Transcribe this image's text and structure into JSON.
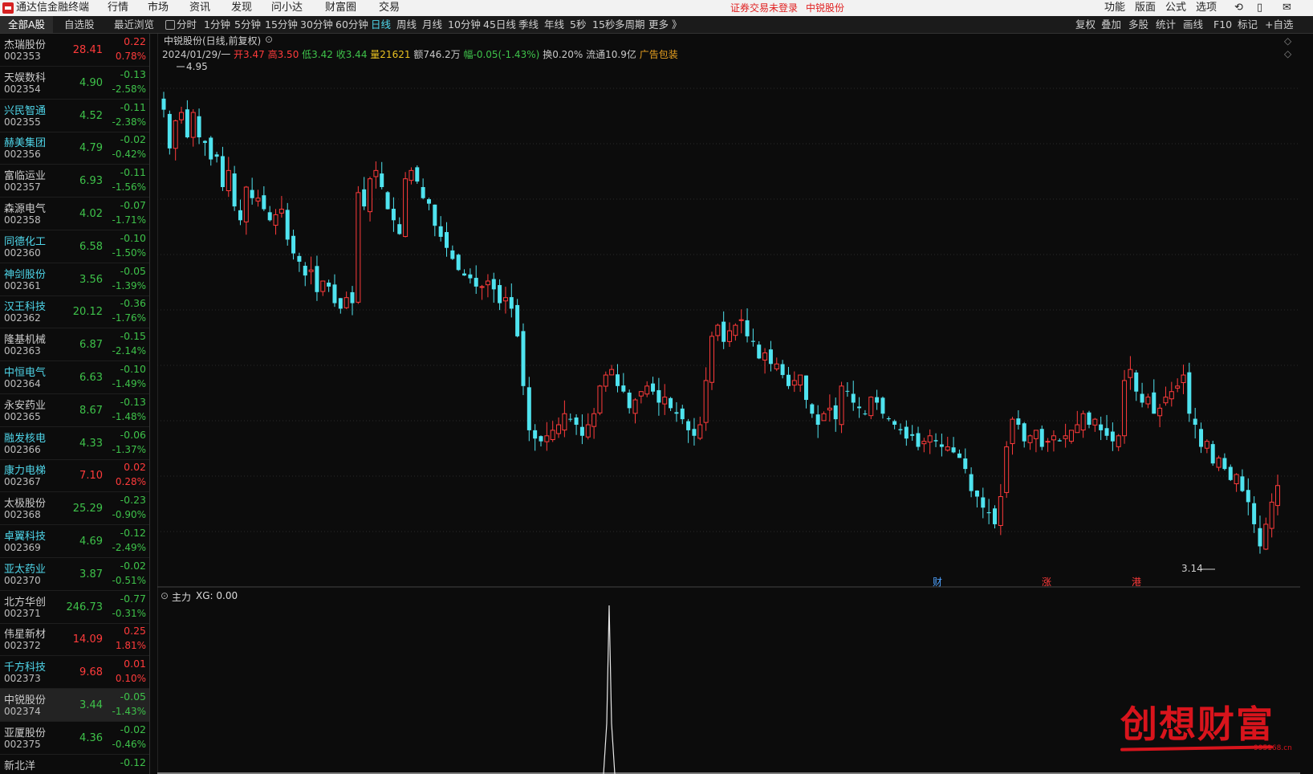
{
  "menubar": {
    "app_title": "通达信金融终端",
    "items": [
      "行情",
      "市场",
      "资讯",
      "发现",
      "问小达",
      "财富圈",
      "交易"
    ],
    "notice": "证券交易未登录",
    "stock_name": "中锐股份",
    "right_items": [
      "功能",
      "版面",
      "公式",
      "选项"
    ]
  },
  "toolbar": {
    "sidebar_tabs": [
      "全部A股",
      "自选股",
      "最近浏览"
    ],
    "periods": [
      "分时",
      "1分钟",
      "5分钟",
      "15分钟",
      "30分钟",
      "60分钟",
      "日线",
      "周线",
      "月线",
      "10分钟",
      "45日线",
      "季线",
      "年线",
      "5秒",
      "15秒",
      "多周期",
      "更多 》"
    ],
    "active_period": "日线",
    "right_tools": [
      "复权",
      "叠加",
      "多股",
      "统计",
      "画线",
      "F10",
      "标记",
      "+自选"
    ]
  },
  "stocks": [
    {
      "name": "杰瑞股份",
      "code": "002353",
      "price": "28.41",
      "change": "0.22",
      "pct": "0.78%",
      "dir": "up",
      "hl": false
    },
    {
      "name": "天娱数科",
      "code": "002354",
      "price": "4.90",
      "change": "-0.13",
      "pct": "-2.58%",
      "dir": "dn",
      "hl": false
    },
    {
      "name": "兴民智通",
      "code": "002355",
      "price": "4.52",
      "change": "-0.11",
      "pct": "-2.38%",
      "dir": "dn",
      "hl": true
    },
    {
      "name": "赫美集团",
      "code": "002356",
      "price": "4.79",
      "change": "-0.02",
      "pct": "-0.42%",
      "dir": "dn",
      "hl": true
    },
    {
      "name": "富临运业",
      "code": "002357",
      "price": "6.93",
      "change": "-0.11",
      "pct": "-1.56%",
      "dir": "dn",
      "hl": false
    },
    {
      "name": "森源电气",
      "code": "002358",
      "price": "4.02",
      "change": "-0.07",
      "pct": "-1.71%",
      "dir": "dn",
      "hl": false
    },
    {
      "name": "同德化工",
      "code": "002360",
      "price": "6.58",
      "change": "-0.10",
      "pct": "-1.50%",
      "dir": "dn",
      "hl": true
    },
    {
      "name": "神剑股份",
      "code": "002361",
      "price": "3.56",
      "change": "-0.05",
      "pct": "-1.39%",
      "dir": "dn",
      "hl": true
    },
    {
      "name": "汉王科技",
      "code": "002362",
      "price": "20.12",
      "change": "-0.36",
      "pct": "-1.76%",
      "dir": "dn",
      "hl": true
    },
    {
      "name": "隆基机械",
      "code": "002363",
      "price": "6.87",
      "change": "-0.15",
      "pct": "-2.14%",
      "dir": "dn",
      "hl": false
    },
    {
      "name": "中恒电气",
      "code": "002364",
      "price": "6.63",
      "change": "-0.10",
      "pct": "-1.49%",
      "dir": "dn",
      "hl": true
    },
    {
      "name": "永安药业",
      "code": "002365",
      "price": "8.67",
      "change": "-0.13",
      "pct": "-1.48%",
      "dir": "dn",
      "hl": false
    },
    {
      "name": "融发核电",
      "code": "002366",
      "price": "4.33",
      "change": "-0.06",
      "pct": "-1.37%",
      "dir": "dn",
      "hl": true
    },
    {
      "name": "康力电梯",
      "code": "002367",
      "price": "7.10",
      "change": "0.02",
      "pct": "0.28%",
      "dir": "up",
      "hl": true
    },
    {
      "name": "太极股份",
      "code": "002368",
      "price": "25.29",
      "change": "-0.23",
      "pct": "-0.90%",
      "dir": "dn",
      "hl": false
    },
    {
      "name": "卓翼科技",
      "code": "002369",
      "price": "4.69",
      "change": "-0.12",
      "pct": "-2.49%",
      "dir": "dn",
      "hl": true
    },
    {
      "name": "亚太药业",
      "code": "002370",
      "price": "3.87",
      "change": "-0.02",
      "pct": "-0.51%",
      "dir": "dn",
      "hl": true
    },
    {
      "name": "北方华创",
      "code": "002371",
      "price": "246.73",
      "change": "-0.77",
      "pct": "-0.31%",
      "dir": "dn",
      "hl": false
    },
    {
      "name": "伟星新材",
      "code": "002372",
      "price": "14.09",
      "change": "0.25",
      "pct": "1.81%",
      "dir": "up",
      "hl": false
    },
    {
      "name": "千方科技",
      "code": "002373",
      "price": "9.68",
      "change": "0.01",
      "pct": "0.10%",
      "dir": "up",
      "hl": true
    },
    {
      "name": "中锐股份",
      "code": "002374",
      "price": "3.44",
      "change": "-0.05",
      "pct": "-1.43%",
      "dir": "dn",
      "hl": false,
      "current": true
    },
    {
      "name": "亚厦股份",
      "code": "002375",
      "price": "4.36",
      "change": "-0.02",
      "pct": "-0.46%",
      "dir": "dn",
      "hl": false
    },
    {
      "name": "新北洋",
      "code": "",
      "price": "",
      "change": "-0.12",
      "pct": "",
      "dir": "dn",
      "hl": false
    }
  ],
  "chart_header": {
    "title": "中锐股份(日线,前复权)",
    "date": "2024/01/29/一",
    "open": "开3.47",
    "high": "高3.50",
    "low": "低3.42",
    "close": "收3.44",
    "volume": "量21621",
    "amount": "额746.2万",
    "range": "幅-0.05(-1.43%)",
    "turnover": "换0.20%",
    "float": "流通10.9亿",
    "badge": "广告包装"
  },
  "indicator": {
    "label": "主力",
    "value": "XG: 0.00"
  },
  "event_markers": [
    "财",
    "涨",
    "港"
  ],
  "watermark": {
    "text": "创想财富",
    "url": "995168.cn"
  },
  "colors": {
    "up": "#ff3b3b",
    "down": "#4fe3ef",
    "panel": "#0c0c0c",
    "accent": "#4fd6ea"
  },
  "chart_data": {
    "type": "candlestick",
    "symbol": "中锐股份",
    "period": "日线",
    "y_range": [
      3.14,
      4.95
    ],
    "max_label": "4.95",
    "min_label": "3.14",
    "last_bar": {
      "open": 3.47,
      "high": 3.5,
      "low": 3.42,
      "close": 3.44
    },
    "path": [
      4.8,
      4.66,
      4.76,
      4.79,
      4.7,
      4.79,
      4.7,
      4.68,
      4.62,
      4.63,
      4.52,
      4.58,
      4.45,
      4.4,
      4.52,
      4.48,
      4.48,
      4.44,
      4.4,
      4.42,
      4.44,
      4.33,
      4.28,
      4.25,
      4.2,
      4.22,
      4.14,
      4.18,
      4.16,
      4.1,
      4.08,
      4.12,
      4.1,
      4.5,
      4.45,
      4.55,
      4.58,
      4.52,
      4.44,
      4.4,
      4.35,
      4.55,
      4.58,
      4.54,
      4.48,
      4.46,
      4.38,
      4.34,
      4.3,
      4.26,
      4.22,
      4.2,
      4.19,
      4.16,
      4.16,
      4.18,
      4.15,
      4.1,
      4.12,
      4.08,
      3.98,
      3.8,
      3.64,
      3.61,
      3.6,
      3.62,
      3.64,
      3.66,
      3.7,
      3.68,
      3.66,
      3.62,
      3.66,
      3.7,
      3.8,
      3.84,
      3.86,
      3.8,
      3.78,
      3.72,
      3.75,
      3.78,
      3.8,
      3.78,
      3.74,
      3.76,
      3.72,
      3.7,
      3.68,
      3.64,
      3.62,
      3.66,
      3.82,
      3.98,
      4.02,
      3.96,
      4.0,
      4.02,
      4.04,
      3.98,
      3.96,
      3.9,
      3.92,
      3.88,
      3.88,
      3.84,
      3.8,
      3.82,
      3.84,
      3.75,
      3.7,
      3.66,
      3.7,
      3.72,
      3.68,
      3.8,
      3.78,
      3.74,
      3.72,
      3.7,
      3.76,
      3.74,
      3.7,
      3.68,
      3.66,
      3.64,
      3.61,
      3.62,
      3.58,
      3.6,
      3.62,
      3.6,
      3.58,
      3.58,
      3.56,
      3.54,
      3.5,
      3.42,
      3.4,
      3.36,
      3.34,
      3.3,
      3.4,
      3.58,
      3.68,
      3.66,
      3.6,
      3.62,
      3.64,
      3.58,
      3.6,
      3.62,
      3.6,
      3.62,
      3.64,
      3.66,
      3.7,
      3.66,
      3.68,
      3.64,
      3.62,
      3.6,
      3.62,
      3.82,
      3.86,
      3.78,
      3.74,
      3.76,
      3.7,
      3.72,
      3.76,
      3.78,
      3.8,
      3.84,
      3.7,
      3.66,
      3.58,
      3.6,
      3.52,
      3.54,
      3.5,
      3.46,
      3.48,
      3.42,
      3.38,
      3.3,
      3.22,
      3.3,
      3.38,
      3.44
    ]
  }
}
